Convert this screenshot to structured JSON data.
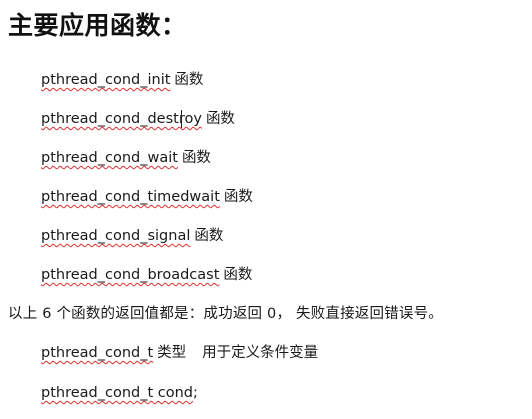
{
  "heading": "主要应用函数：",
  "functions": [
    {
      "name": "pthread_cond_init",
      "suffix": "函数"
    },
    {
      "name": "pthread_cond_destroy",
      "suffix": "函数"
    },
    {
      "name": "pthread_cond_wait",
      "suffix": "函数"
    },
    {
      "name": "pthread_cond_timedwait",
      "suffix": "函数"
    },
    {
      "name": "pthread_cond_signal",
      "suffix": "函数"
    },
    {
      "name": "pthread_cond_broadcast",
      "suffix": "函数"
    }
  ],
  "summary": "以上 6 个函数的返回值都是：成功返回 0， 失败直接返回错误号。",
  "type_line": {
    "code": "pthread_cond_t",
    "label": "类型",
    "description": "用于定义条件变量"
  },
  "declaration": {
    "code": "pthread_cond_t cond",
    "punct": ";"
  },
  "colors": {
    "text": "#1a1a1a",
    "spellcheck_underline": "#e03030"
  }
}
